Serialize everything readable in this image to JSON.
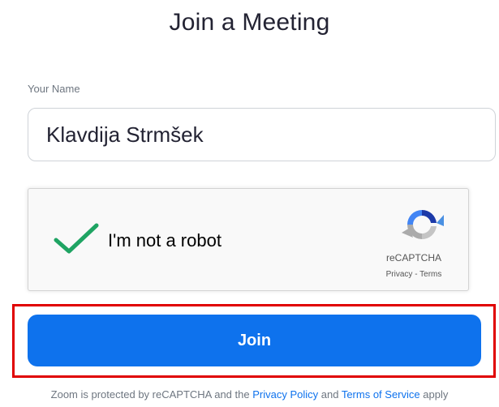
{
  "page": {
    "title": "Join a Meeting"
  },
  "form": {
    "name_label": "Your Name",
    "name_value": "Klavdija Strmšek"
  },
  "captcha": {
    "label": "I'm not a robot",
    "checked": true,
    "brand": "reCAPTCHA",
    "privacy_link": "Privacy",
    "separator": " - ",
    "terms_link": "Terms",
    "check_color": "#1fa463",
    "logo_icon": "recaptcha-logo-icon"
  },
  "join_button": {
    "label": "Join",
    "color": "#0e72ed"
  },
  "highlight": {
    "color": "#e00000"
  },
  "footer": {
    "text_before": "Zoom is protected by reCAPTCHA and the ",
    "privacy_policy_link": "Privacy Policy",
    "text_middle": " and ",
    "terms_of_service_link": "Terms of Service",
    "text_after": " apply"
  }
}
